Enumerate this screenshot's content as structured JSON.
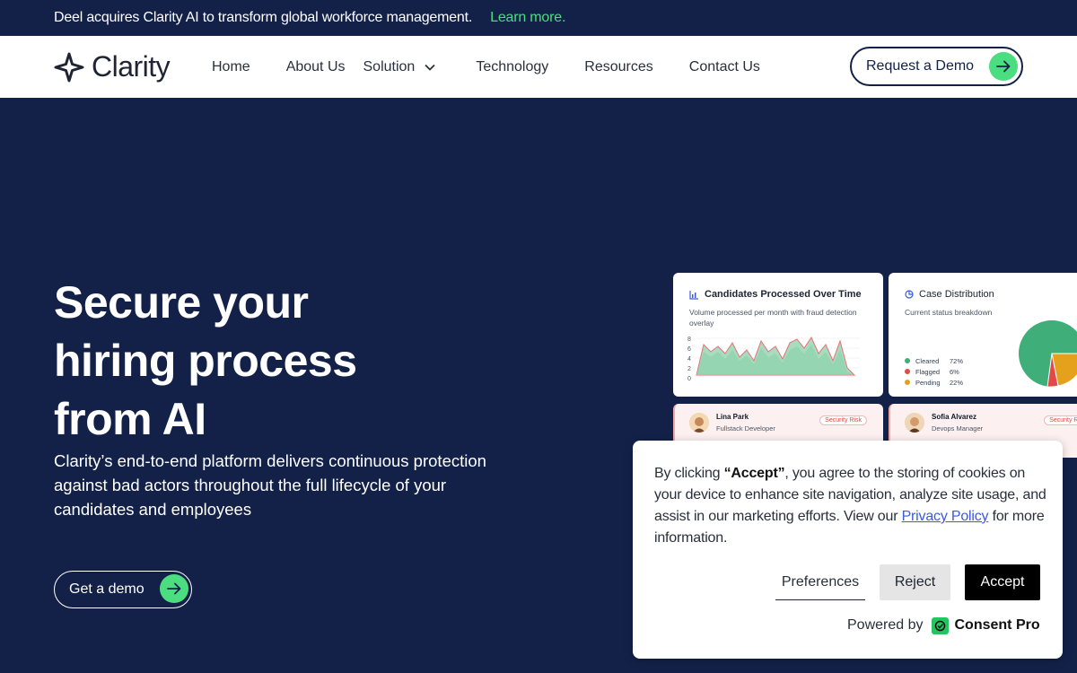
{
  "announcement": {
    "message": "Deel acquires Clarity AI to transform global workforce management.",
    "link": "Learn more",
    "link_suffix": "."
  },
  "nav": {
    "logo_text": "Clarity",
    "items": [
      "Home",
      "About Us",
      "Solution",
      "Technology",
      "Resources",
      "Contact Us"
    ],
    "cta": "Request a Demo"
  },
  "hero": {
    "title_lines": [
      "Secure your",
      "hiring process",
      "from AI"
    ],
    "subtitle": "Clarity’s end-to-end platform delivers continuous protection against bad actors throughout the full lifecycle of your candidates and employees",
    "cta": "Get a demo"
  },
  "dashboard": {
    "candidates_card": {
      "title": "Candidates Processed Over Time",
      "subtitle": "Volume processed per month with fraud detection overlay",
      "y_ticks": [
        "8",
        "6",
        "4",
        "2",
        "0"
      ]
    },
    "case_card": {
      "title": "Case Distribution",
      "subtitle": "Current status breakdown",
      "legend": [
        {
          "label": "Cleared",
          "value": "72%",
          "color": "#3fae78"
        },
        {
          "label": "Flagged",
          "value": "6%",
          "color": "#e24a4a"
        },
        {
          "label": "Pending",
          "value": "22%",
          "color": "#e6a11c"
        }
      ]
    },
    "people": [
      {
        "name": "Lina Park",
        "role": "Fullstack Developer",
        "badge": "Security Risk"
      },
      {
        "name": "Sofia Alvarez",
        "role": "Devops Manager",
        "badge": "Security Risk"
      }
    ]
  },
  "cookie": {
    "text_before": "By clicking ",
    "text_bold": "“Accept”",
    "text_middle": ", you agree to the storing of cookies on your device to enhance site navigation, analyze site usage, and assist in our marketing efforts. View our ",
    "link": "Privacy Policy",
    "text_after": " for more information.",
    "preferences": "Preferences",
    "reject": "Reject",
    "accept": "Accept",
    "powered_by": "Powered by",
    "brand": "Consent Pro"
  },
  "colors": {
    "navy": "#132149",
    "accent": "#4ade80"
  }
}
